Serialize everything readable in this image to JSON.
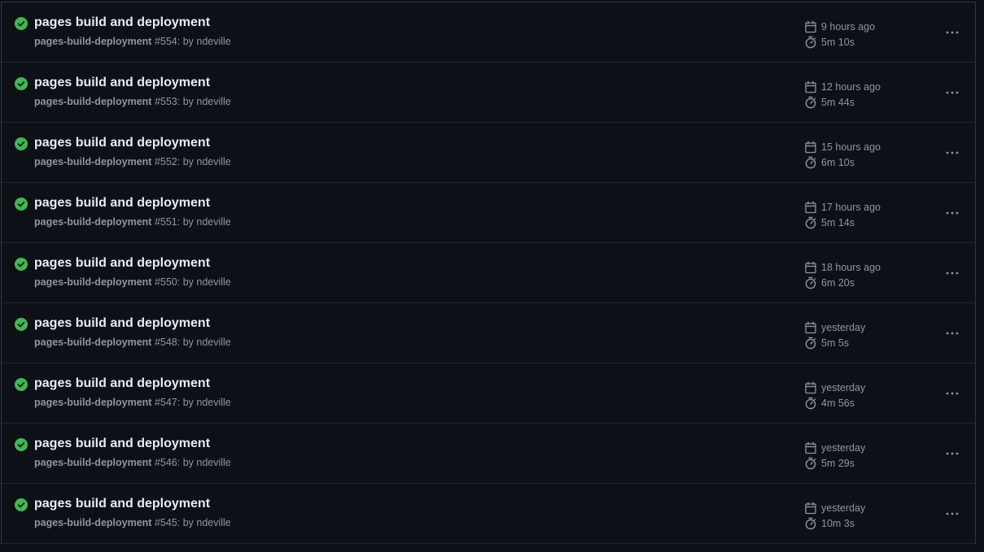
{
  "colors": {
    "background": "#0d1117",
    "success": "#3fb950",
    "title_text": "#e6edf3",
    "muted_text": "#8d96a0",
    "border": "#30363d"
  },
  "runs": [
    {
      "title": "pages build and deployment",
      "workflow": "pages-build-deployment",
      "run_info": "#554: by ndeville",
      "status_icon": "check-circle-fill-icon",
      "status": "success",
      "created": "9 hours ago",
      "duration": "5m 10s"
    },
    {
      "title": "pages build and deployment",
      "workflow": "pages-build-deployment",
      "run_info": "#553: by ndeville",
      "status_icon": "check-circle-fill-icon",
      "status": "success",
      "created": "12 hours ago",
      "duration": "5m 44s"
    },
    {
      "title": "pages build and deployment",
      "workflow": "pages-build-deployment",
      "run_info": "#552: by ndeville",
      "status_icon": "check-circle-fill-icon",
      "status": "success",
      "created": "15 hours ago",
      "duration": "6m 10s"
    },
    {
      "title": "pages build and deployment",
      "workflow": "pages-build-deployment",
      "run_info": "#551: by ndeville",
      "status_icon": "check-circle-fill-icon",
      "status": "success",
      "created": "17 hours ago",
      "duration": "5m 14s"
    },
    {
      "title": "pages build and deployment",
      "workflow": "pages-build-deployment",
      "run_info": "#550: by ndeville",
      "status_icon": "check-circle-fill-icon",
      "status": "success",
      "created": "18 hours ago",
      "duration": "6m 20s"
    },
    {
      "title": "pages build and deployment",
      "workflow": "pages-build-deployment",
      "run_info": "#548: by ndeville",
      "status_icon": "check-circle-fill-icon",
      "status": "success",
      "created": "yesterday",
      "duration": "5m 5s"
    },
    {
      "title": "pages build and deployment",
      "workflow": "pages-build-deployment",
      "run_info": "#547: by ndeville",
      "status_icon": "check-circle-fill-icon",
      "status": "success",
      "created": "yesterday",
      "duration": "4m 56s"
    },
    {
      "title": "pages build and deployment",
      "workflow": "pages-build-deployment",
      "run_info": "#546: by ndeville",
      "status_icon": "check-circle-fill-icon",
      "status": "success",
      "created": "yesterday",
      "duration": "5m 29s"
    },
    {
      "title": "pages build and deployment",
      "workflow": "pages-build-deployment",
      "run_info": "#545: by ndeville",
      "status_icon": "check-circle-fill-icon",
      "status": "success",
      "created": "yesterday",
      "duration": "10m 3s"
    }
  ],
  "icons": {
    "created": "calendar-icon",
    "duration": "stopwatch-icon",
    "menu": "kebab-horizontal-icon"
  }
}
